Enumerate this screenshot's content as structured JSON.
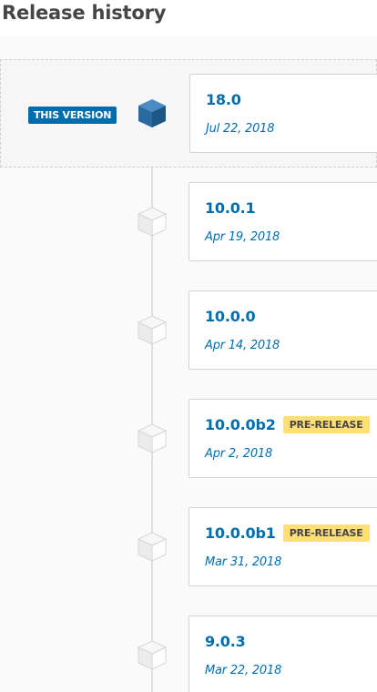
{
  "page": {
    "title": "Release history"
  },
  "current_badge": "THIS VERSION",
  "icons": {
    "current": "cube-icon-filled-blue",
    "other": "cube-icon-outline-gray"
  },
  "colors": {
    "link": "#006dad",
    "current_badge_bg": "#006dad",
    "pre_release_badge_bg": "#ffdf76",
    "timeline_line": "#e0e0e0"
  },
  "releases": [
    {
      "version": "18.0",
      "date": "Jul 22, 2018",
      "pre_release": "",
      "current": true
    },
    {
      "version": "10.0.1",
      "date": "Apr 19, 2018",
      "pre_release": "",
      "current": false
    },
    {
      "version": "10.0.0",
      "date": "Apr 14, 2018",
      "pre_release": "",
      "current": false
    },
    {
      "version": "10.0.0b2",
      "date": "Apr 2, 2018",
      "pre_release": "PRE-RELEASE",
      "current": false
    },
    {
      "version": "10.0.0b1",
      "date": "Mar 31, 2018",
      "pre_release": "PRE-RELEASE",
      "current": false
    },
    {
      "version": "9.0.3",
      "date": "Mar 22, 2018",
      "pre_release": "",
      "current": false
    }
  ]
}
